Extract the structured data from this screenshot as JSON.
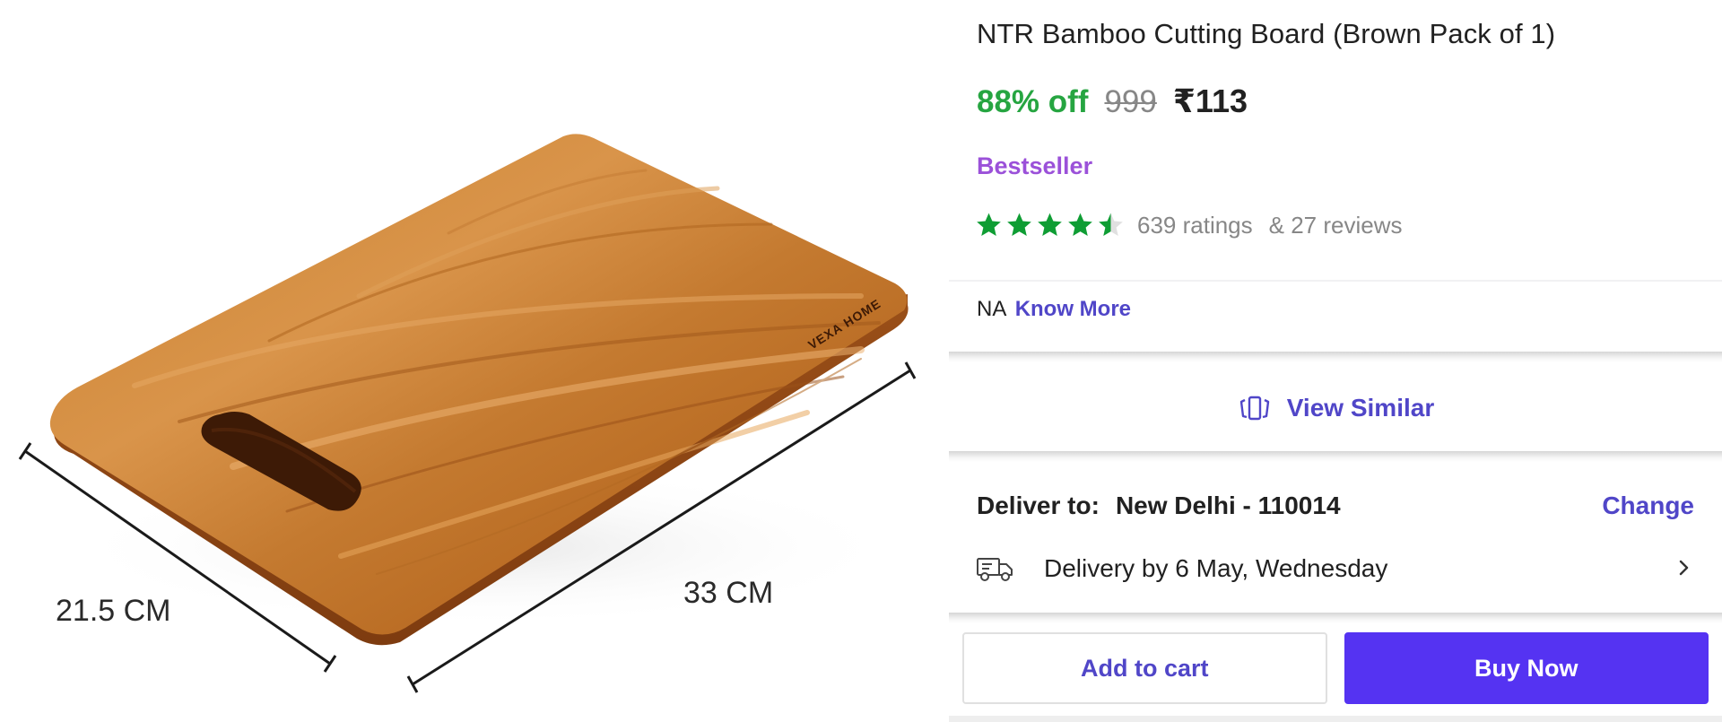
{
  "product_image": {
    "alt": "Bamboo cutting board with dimension markers",
    "brand_engraving": "VEXA HOME",
    "dimension_width": "21.5 CM",
    "dimension_length": "33 CM"
  },
  "product": {
    "title": "NTR Bamboo Cutting Board (Brown Pack of 1)",
    "discount": "88% off",
    "mrp": "999",
    "price": "₹113",
    "badge": "Bestseller",
    "rating_value": 4.5,
    "rating_max": 5,
    "ratings_count": "639 ratings",
    "reviews_count": "& 27 reviews"
  },
  "info": {
    "na_text": "NA",
    "know_more": "Know More"
  },
  "view_similar": {
    "label": "View Similar",
    "icon": "view-similar-icon"
  },
  "delivery": {
    "deliver_to_label": "Deliver to:",
    "location": "New Delhi - 110014",
    "change_label": "Change",
    "delivery_text": "Delivery by 6 May, Wednesday",
    "icon": "truck-icon"
  },
  "actions": {
    "add_to_cart": "Add to cart",
    "buy_now": "Buy Now"
  },
  "colors": {
    "accent": "#5046c8",
    "buy_button": "#5533f2",
    "discount_green": "#26a541",
    "star_green": "#0f9d34",
    "bestseller_purple": "#9b51d9"
  }
}
